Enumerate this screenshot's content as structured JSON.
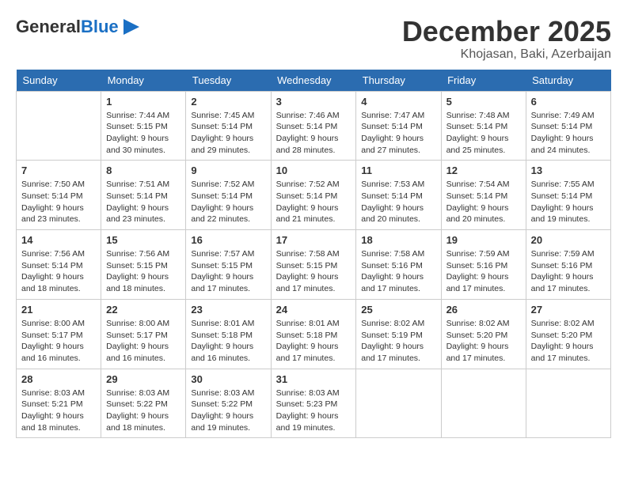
{
  "logo": {
    "general": "General",
    "blue": "Blue"
  },
  "header": {
    "month": "December 2025",
    "location": "Khojasan, Baki, Azerbaijan"
  },
  "weekdays": [
    "Sunday",
    "Monday",
    "Tuesday",
    "Wednesday",
    "Thursday",
    "Friday",
    "Saturday"
  ],
  "weeks": [
    [
      {
        "day": "",
        "sunrise": "",
        "sunset": "",
        "daylight": ""
      },
      {
        "day": "1",
        "sunrise": "Sunrise: 7:44 AM",
        "sunset": "Sunset: 5:15 PM",
        "daylight": "Daylight: 9 hours and 30 minutes."
      },
      {
        "day": "2",
        "sunrise": "Sunrise: 7:45 AM",
        "sunset": "Sunset: 5:14 PM",
        "daylight": "Daylight: 9 hours and 29 minutes."
      },
      {
        "day": "3",
        "sunrise": "Sunrise: 7:46 AM",
        "sunset": "Sunset: 5:14 PM",
        "daylight": "Daylight: 9 hours and 28 minutes."
      },
      {
        "day": "4",
        "sunrise": "Sunrise: 7:47 AM",
        "sunset": "Sunset: 5:14 PM",
        "daylight": "Daylight: 9 hours and 27 minutes."
      },
      {
        "day": "5",
        "sunrise": "Sunrise: 7:48 AM",
        "sunset": "Sunset: 5:14 PM",
        "daylight": "Daylight: 9 hours and 25 minutes."
      },
      {
        "day": "6",
        "sunrise": "Sunrise: 7:49 AM",
        "sunset": "Sunset: 5:14 PM",
        "daylight": "Daylight: 9 hours and 24 minutes."
      }
    ],
    [
      {
        "day": "7",
        "sunrise": "Sunrise: 7:50 AM",
        "sunset": "Sunset: 5:14 PM",
        "daylight": "Daylight: 9 hours and 23 minutes."
      },
      {
        "day": "8",
        "sunrise": "Sunrise: 7:51 AM",
        "sunset": "Sunset: 5:14 PM",
        "daylight": "Daylight: 9 hours and 23 minutes."
      },
      {
        "day": "9",
        "sunrise": "Sunrise: 7:52 AM",
        "sunset": "Sunset: 5:14 PM",
        "daylight": "Daylight: 9 hours and 22 minutes."
      },
      {
        "day": "10",
        "sunrise": "Sunrise: 7:52 AM",
        "sunset": "Sunset: 5:14 PM",
        "daylight": "Daylight: 9 hours and 21 minutes."
      },
      {
        "day": "11",
        "sunrise": "Sunrise: 7:53 AM",
        "sunset": "Sunset: 5:14 PM",
        "daylight": "Daylight: 9 hours and 20 minutes."
      },
      {
        "day": "12",
        "sunrise": "Sunrise: 7:54 AM",
        "sunset": "Sunset: 5:14 PM",
        "daylight": "Daylight: 9 hours and 20 minutes."
      },
      {
        "day": "13",
        "sunrise": "Sunrise: 7:55 AM",
        "sunset": "Sunset: 5:14 PM",
        "daylight": "Daylight: 9 hours and 19 minutes."
      }
    ],
    [
      {
        "day": "14",
        "sunrise": "Sunrise: 7:56 AM",
        "sunset": "Sunset: 5:14 PM",
        "daylight": "Daylight: 9 hours and 18 minutes."
      },
      {
        "day": "15",
        "sunrise": "Sunrise: 7:56 AM",
        "sunset": "Sunset: 5:15 PM",
        "daylight": "Daylight: 9 hours and 18 minutes."
      },
      {
        "day": "16",
        "sunrise": "Sunrise: 7:57 AM",
        "sunset": "Sunset: 5:15 PM",
        "daylight": "Daylight: 9 hours and 17 minutes."
      },
      {
        "day": "17",
        "sunrise": "Sunrise: 7:58 AM",
        "sunset": "Sunset: 5:15 PM",
        "daylight": "Daylight: 9 hours and 17 minutes."
      },
      {
        "day": "18",
        "sunrise": "Sunrise: 7:58 AM",
        "sunset": "Sunset: 5:16 PM",
        "daylight": "Daylight: 9 hours and 17 minutes."
      },
      {
        "day": "19",
        "sunrise": "Sunrise: 7:59 AM",
        "sunset": "Sunset: 5:16 PM",
        "daylight": "Daylight: 9 hours and 17 minutes."
      },
      {
        "day": "20",
        "sunrise": "Sunrise: 7:59 AM",
        "sunset": "Sunset: 5:16 PM",
        "daylight": "Daylight: 9 hours and 17 minutes."
      }
    ],
    [
      {
        "day": "21",
        "sunrise": "Sunrise: 8:00 AM",
        "sunset": "Sunset: 5:17 PM",
        "daylight": "Daylight: 9 hours and 16 minutes."
      },
      {
        "day": "22",
        "sunrise": "Sunrise: 8:00 AM",
        "sunset": "Sunset: 5:17 PM",
        "daylight": "Daylight: 9 hours and 16 minutes."
      },
      {
        "day": "23",
        "sunrise": "Sunrise: 8:01 AM",
        "sunset": "Sunset: 5:18 PM",
        "daylight": "Daylight: 9 hours and 16 minutes."
      },
      {
        "day": "24",
        "sunrise": "Sunrise: 8:01 AM",
        "sunset": "Sunset: 5:18 PM",
        "daylight": "Daylight: 9 hours and 17 minutes."
      },
      {
        "day": "25",
        "sunrise": "Sunrise: 8:02 AM",
        "sunset": "Sunset: 5:19 PM",
        "daylight": "Daylight: 9 hours and 17 minutes."
      },
      {
        "day": "26",
        "sunrise": "Sunrise: 8:02 AM",
        "sunset": "Sunset: 5:20 PM",
        "daylight": "Daylight: 9 hours and 17 minutes."
      },
      {
        "day": "27",
        "sunrise": "Sunrise: 8:02 AM",
        "sunset": "Sunset: 5:20 PM",
        "daylight": "Daylight: 9 hours and 17 minutes."
      }
    ],
    [
      {
        "day": "28",
        "sunrise": "Sunrise: 8:03 AM",
        "sunset": "Sunset: 5:21 PM",
        "daylight": "Daylight: 9 hours and 18 minutes."
      },
      {
        "day": "29",
        "sunrise": "Sunrise: 8:03 AM",
        "sunset": "Sunset: 5:22 PM",
        "daylight": "Daylight: 9 hours and 18 minutes."
      },
      {
        "day": "30",
        "sunrise": "Sunrise: 8:03 AM",
        "sunset": "Sunset: 5:22 PM",
        "daylight": "Daylight: 9 hours and 19 minutes."
      },
      {
        "day": "31",
        "sunrise": "Sunrise: 8:03 AM",
        "sunset": "Sunset: 5:23 PM",
        "daylight": "Daylight: 9 hours and 19 minutes."
      },
      {
        "day": "",
        "sunrise": "",
        "sunset": "",
        "daylight": ""
      },
      {
        "day": "",
        "sunrise": "",
        "sunset": "",
        "daylight": ""
      },
      {
        "day": "",
        "sunrise": "",
        "sunset": "",
        "daylight": ""
      }
    ]
  ]
}
